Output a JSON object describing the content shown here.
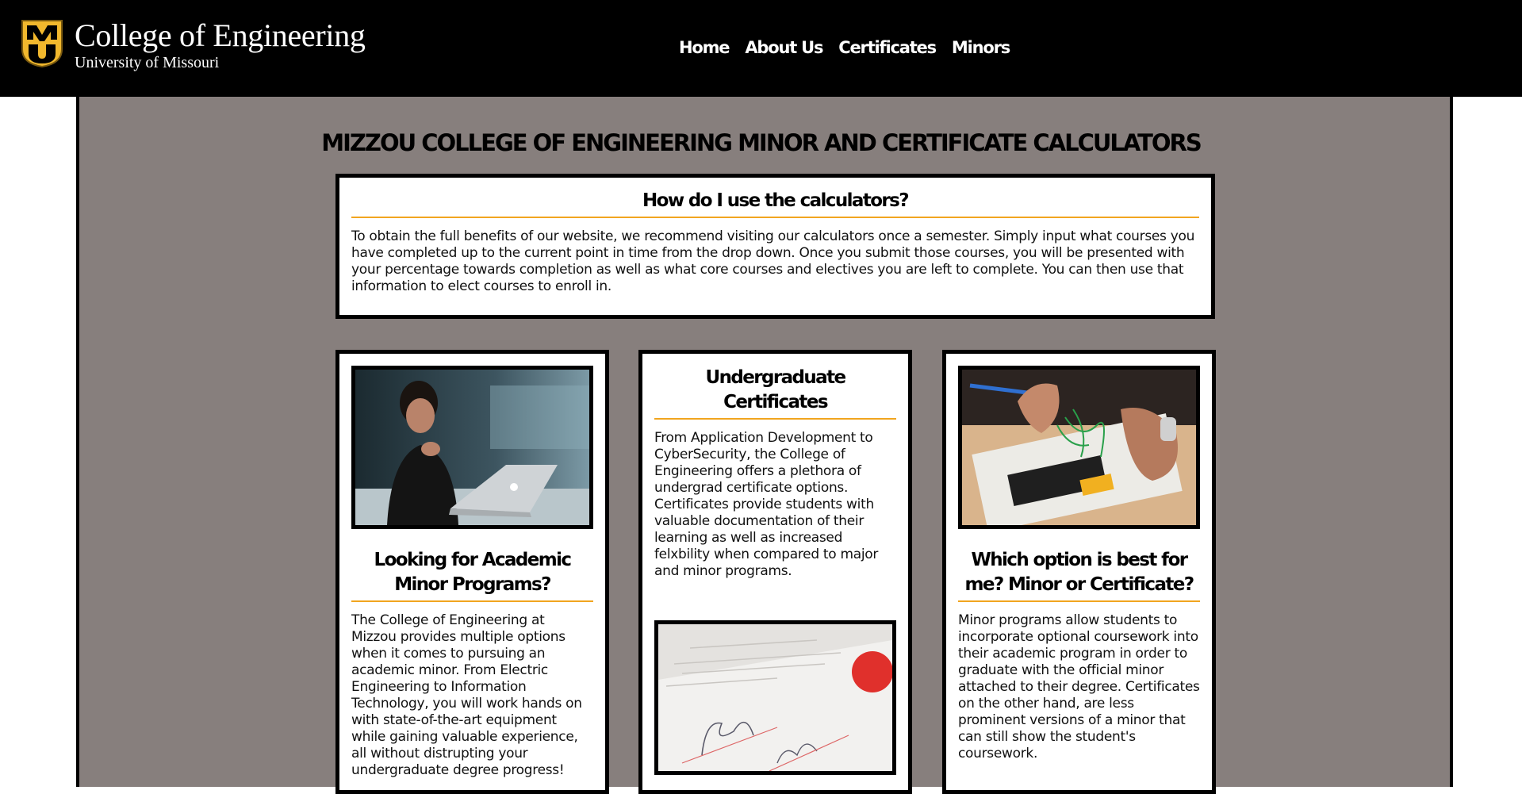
{
  "header": {
    "logo_mark": "MU",
    "title": "College of Engineering",
    "subtitle": "University of Missouri",
    "bg_color": "#000000"
  },
  "nav": {
    "items": [
      "Home",
      "About Us",
      "Certificates",
      "Minors"
    ]
  },
  "page": {
    "title": "MIZZOU COLLEGE OF ENGINEERING MINOR AND CERTIFICATE CALCULATORS",
    "panel_color": "#877f7d",
    "accent_color": "#f1a51f"
  },
  "how_to": {
    "heading": "How do I use the calculators?",
    "body": "To obtain the full benefits of our website, we recommend visiting our calculators once a semester. Simply input what courses you have completed up to the current point in time from the drop down. Once you submit those courses, you will be presented with your percentage towards completion as well as what core courses and electives you are left to complete. You can then use that information to elect courses to enroll in."
  },
  "cards": {
    "minor": {
      "image": "student-with-laptop-photo",
      "heading": "Looking for Academic Minor Programs?",
      "body": "The College of Engineering at Mizzou provides multiple options when it comes to pursuing an academic minor. From Electric Engineering to Information Technology, you will work hands on with state-of-the-art equipment while gaining valuable experience, all without distrupting your undergraduate degree progress!"
    },
    "certificates": {
      "heading": "Undergraduate Certificates",
      "body": "From Application Development to CyberSecurity, the College of Engineering offers a plethora of undergrad certificate options. Certificates provide students with valuable documentation of their learning as well as increased felxbility when compared to major and minor programs.",
      "image": "signed-certificate-photo"
    },
    "compare": {
      "image": "circuit-breadboard-photo",
      "heading": "Which option is best for me? Minor or Certificate?",
      "body": "Minor programs allow students to incorporate optional coursework into their academic program in order to graduate with the official minor attached to their degree. Certificates on the other hand, are less prominent versions of a minor that can still show the student's coursework."
    }
  }
}
